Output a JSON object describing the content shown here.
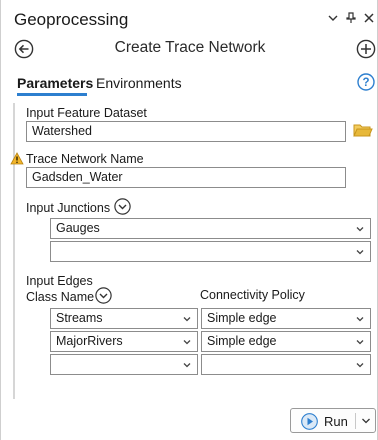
{
  "pane": {
    "title": "Geoprocessing"
  },
  "tool": {
    "title": "Create Trace Network"
  },
  "tabs": [
    {
      "label": "Parameters",
      "active": true
    },
    {
      "label": "Environments",
      "active": false
    }
  ],
  "params": {
    "input_feature_dataset": {
      "label": "Input Feature Dataset",
      "value": "Watershed"
    },
    "trace_network_name": {
      "label": "Trace Network Name",
      "value": "Gadsden_Water"
    },
    "input_junctions": {
      "label": "Input Junctions",
      "rows": [
        "Gauges",
        ""
      ]
    },
    "input_edges": {
      "label": "Input Edges",
      "col_class": "Class Name",
      "col_policy": "Connectivity Policy",
      "rows": [
        {
          "class": "Streams",
          "policy": "Simple edge"
        },
        {
          "class": "MajorRivers",
          "policy": "Simple edge"
        },
        {
          "class": "",
          "policy": ""
        }
      ]
    }
  },
  "run": {
    "label": "Run"
  },
  "colors": {
    "accent": "#2d7fcf",
    "warning": "#e8a317",
    "folder": "#d9a520"
  }
}
